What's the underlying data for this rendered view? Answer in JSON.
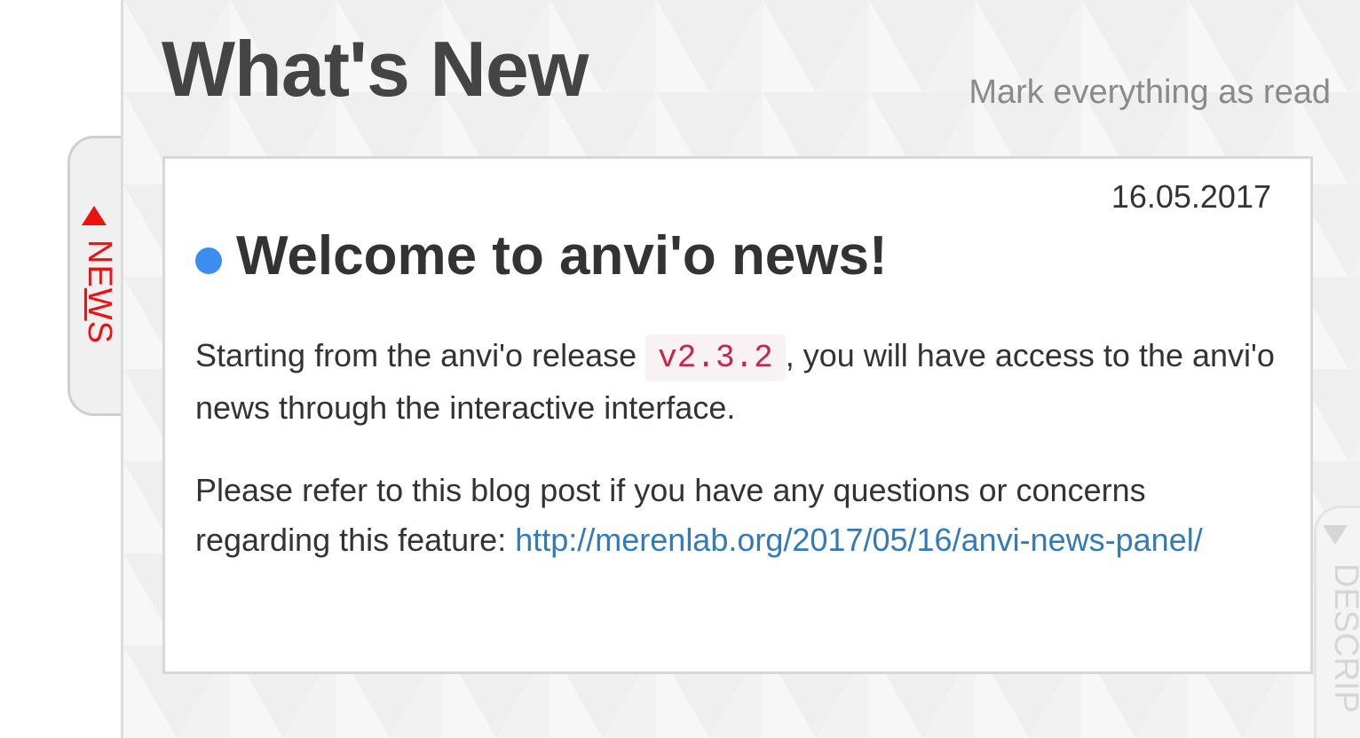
{
  "header": {
    "title": "What's New",
    "mark_all_read": "Mark everything as read"
  },
  "news_item": {
    "date": "16.05.2017",
    "title": "Welcome to anvi'o news!",
    "unread": true,
    "paragraph1_before": "Starting from the anvi'o release ",
    "version": "v2.3.2",
    "paragraph1_after": ", you will have access to the anvi'o news through the interactive interface.",
    "paragraph2_before": "Please refer to this blog post if you have any questions or concerns regarding this feature: ",
    "link_text": "http://merenlab.org/2017/05/16/anvi-news-panel/"
  },
  "side_tabs": {
    "news": {
      "label_pre": "NE",
      "label_underlined": "W",
      "label_post": "S",
      "color": "#ee1111"
    },
    "description": {
      "label": "DESCRIP"
    }
  },
  "colors": {
    "unread_dot": "#3b8ef0",
    "link": "#337ab7",
    "code": "#c7254e"
  }
}
